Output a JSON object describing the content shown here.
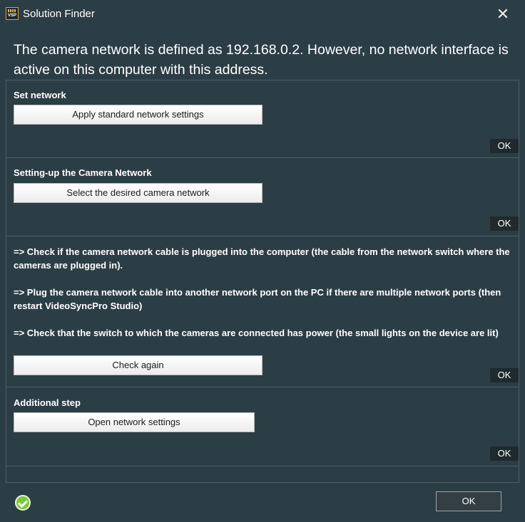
{
  "window": {
    "title": "Solution Finder",
    "app_icon_label": "VSP",
    "close_glyph": "✕"
  },
  "headline": "The camera network is defined as 192.168.0.2. However, no network interface is active on this computer with this address.",
  "sections": [
    {
      "title": "Set network",
      "button_label": "Apply standard network settings",
      "ok_label": "OK"
    },
    {
      "title": "Setting-up the Camera Network",
      "button_label": "Select the desired camera network",
      "ok_label": "OK"
    },
    {
      "steps": [
        "=> Check if the camera network cable is plugged into the computer (the cable from the network switch where the cameras are plugged in).",
        "=> Plug the camera network cable into another network port on the PC if there are multiple network ports (then restart VideoSyncPro Studio)",
        "=> Check that the switch to which the cameras are connected has power (the small lights on the device are lit)"
      ],
      "button_label": "Check again",
      "ok_label": "OK"
    },
    {
      "title": "Additional step",
      "button_label": "Open network settings",
      "ok_label": "OK"
    }
  ],
  "footer": {
    "status_icon": "check-circle-icon",
    "ok_label": "OK"
  },
  "colors": {
    "background": "#2c3e45",
    "ok_badge": "#1f2a2e",
    "success_green": "#7cc63c"
  }
}
